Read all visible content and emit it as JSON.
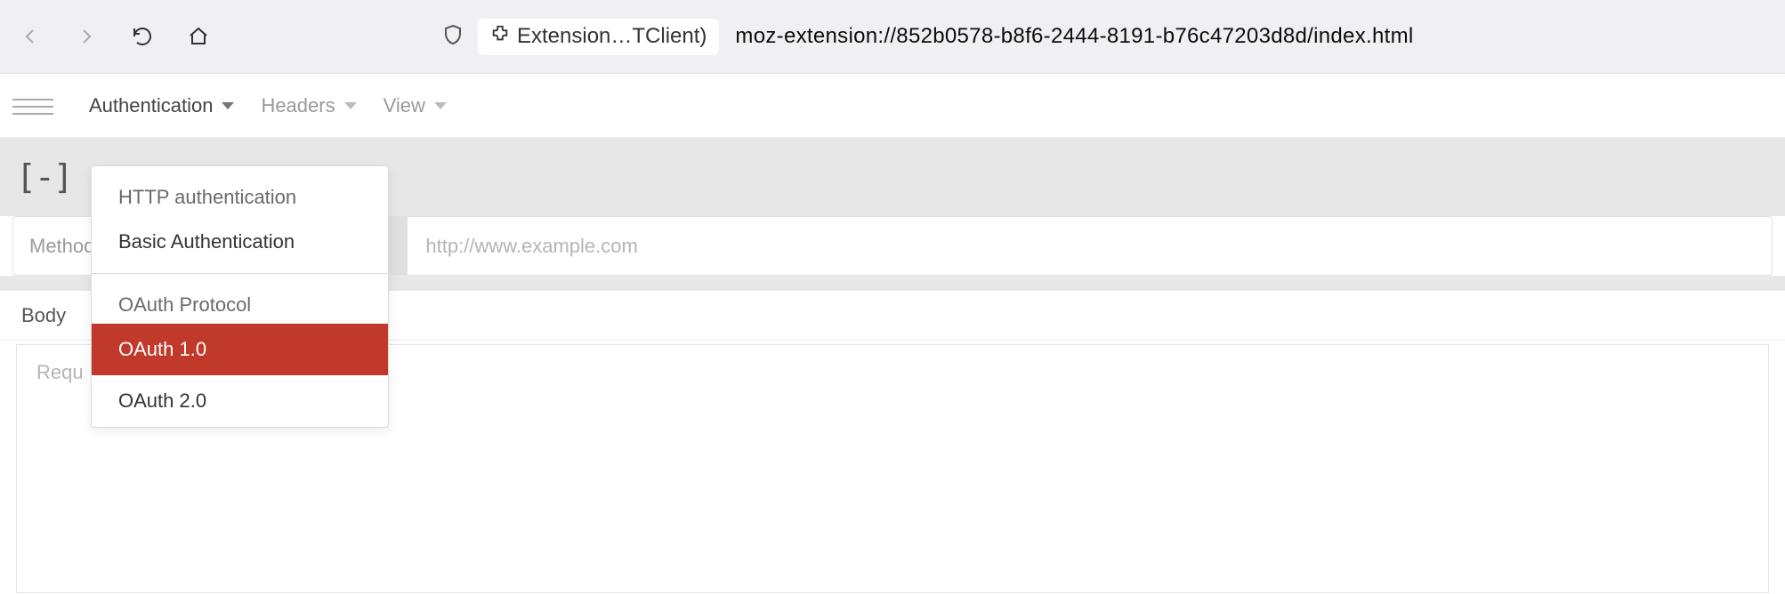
{
  "browser": {
    "extension_label": "Extension…TClient)",
    "url": "moz-extension://852b0578-b8f6-2444-8191-b76c47203d8d/index.html"
  },
  "toolbar": {
    "menu_authentication": "Authentication",
    "menu_headers": "Headers",
    "menu_view": "View"
  },
  "collapse_symbol": "[-]",
  "request": {
    "method_label": "Method",
    "url_placeholder": "http://www.example.com"
  },
  "tabs": {
    "body": "Body"
  },
  "pane": {
    "request_label": "Requ"
  },
  "dropdown": {
    "section_http": "HTTP authentication",
    "item_basic": "Basic Authentication",
    "section_oauth": "OAuth Protocol",
    "item_oauth1": "OAuth 1.0",
    "item_oauth2": "OAuth 2.0"
  }
}
